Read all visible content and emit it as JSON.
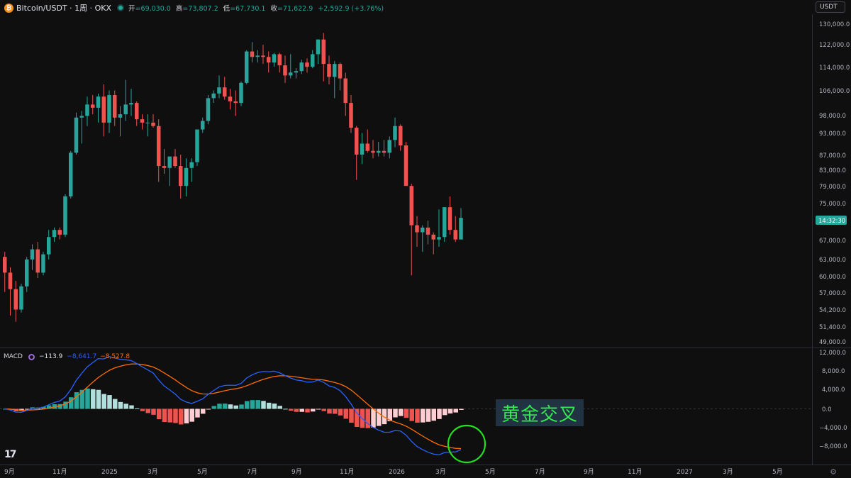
{
  "header": {
    "symbol": "Bitcoin/USDT · 1周 · OKX",
    "open_label": "开",
    "open": "=69,030.0",
    "high_label": "高",
    "high": "=73,807.2",
    "low_label": "低",
    "low": "=67,730.1",
    "close_label": "收",
    "close": "=71,622.9",
    "change": "+2,592.9 (+3.76%)"
  },
  "currency_button": "USDT",
  "price_axis_labels": [
    "130,000.0",
    "122,000.0",
    "114,000.0",
    "106,000.0",
    "98,000.0",
    "93,000.0",
    "87,000.0",
    "83,000.0",
    "79,000.0",
    "75,000.0",
    "67,000.0",
    "63,000.0",
    "60,000.0",
    "57,000.0",
    "54,200.0",
    "51,400.0",
    "49,000.0"
  ],
  "current_price_tag": "14:32:30",
  "macd": {
    "name": "MACD",
    "histogram": "−113.9",
    "macd": "−8,641.7",
    "signal": "−8,527.8",
    "axis_labels": [
      "12,000.0",
      "8,000.0",
      "4,000.0",
      "0.0",
      "−4,000.0",
      "−8,000.0"
    ]
  },
  "time_axis_labels": [
    "9月",
    "11月",
    "2025",
    "3月",
    "5月",
    "7月",
    "9月",
    "11月",
    "2026",
    "3月",
    "5月",
    "7月",
    "9月",
    "11月",
    "2027",
    "3月",
    "5月"
  ],
  "annotation": "黄金交叉",
  "colors": {
    "up": "#26a69a",
    "down": "#ef5350",
    "macd_line": "#2962ff",
    "signal_line": "#ff6d00",
    "annotation_circle": "#22e01e",
    "annotation_text": "#33e84f"
  },
  "chart_data": {
    "type": "candlestick",
    "timeframe": "1W",
    "axis_scale": "log",
    "price_ylim": [
      49000,
      130000
    ],
    "candles_ohlc": [
      [
        63500,
        64500,
        57000,
        60500
      ],
      [
        60500,
        61500,
        53000,
        57500
      ],
      [
        57500,
        59000,
        52000,
        54000
      ],
      [
        54000,
        58500,
        53500,
        58000
      ],
      [
        58000,
        63500,
        57000,
        63000
      ],
      [
        63000,
        66000,
        61000,
        65000
      ],
      [
        65000,
        66500,
        59500,
        60500
      ],
      [
        60500,
        64500,
        60000,
        64000
      ],
      [
        64000,
        69000,
        63000,
        67500
      ],
      [
        67500,
        69500,
        66500,
        69000
      ],
      [
        69000,
        69500,
        67000,
        68000
      ],
      [
        68000,
        77000,
        67500,
        76500
      ],
      [
        76500,
        88000,
        76000,
        87500
      ],
      [
        87500,
        99000,
        87000,
        97500
      ],
      [
        97500,
        99500,
        90000,
        98000
      ],
      [
        98000,
        104000,
        95000,
        101500
      ],
      [
        101500,
        104500,
        98500,
        100500
      ],
      [
        100500,
        105000,
        96000,
        104000
      ],
      [
        104000,
        108000,
        92000,
        96000
      ],
      [
        96000,
        106000,
        93000,
        104500
      ],
      [
        104500,
        106000,
        95000,
        97500
      ],
      [
        97500,
        101000,
        92000,
        98500
      ],
      [
        98500,
        109500,
        96500,
        101500
      ],
      [
        101500,
        106500,
        98000,
        102000
      ],
      [
        102000,
        102500,
        95000,
        97000
      ],
      [
        97000,
        98500,
        94000,
        96000
      ],
      [
        96000,
        98500,
        92000,
        96000
      ],
      [
        96000,
        98500,
        94500,
        95000
      ],
      [
        95000,
        97000,
        80000,
        84000
      ],
      [
        84000,
        88500,
        82000,
        83500
      ],
      [
        83500,
        86000,
        79000,
        86500
      ],
      [
        86500,
        88500,
        83500,
        84000
      ],
      [
        84000,
        87000,
        76000,
        79000
      ],
      [
        79000,
        86000,
        76500,
        83500
      ],
      [
        83500,
        86000,
        80000,
        85000
      ],
      [
        85000,
        93500,
        84000,
        94000
      ],
      [
        94000,
        97500,
        93000,
        96500
      ],
      [
        96500,
        104500,
        95500,
        103500
      ],
      [
        103500,
        106000,
        102000,
        105000
      ],
      [
        105000,
        111000,
        103500,
        107000
      ],
      [
        107000,
        110500,
        103000,
        104000
      ],
      [
        104000,
        106500,
        100000,
        102500
      ],
      [
        102500,
        106000,
        98000,
        102000
      ],
      [
        102000,
        109000,
        101000,
        108500
      ],
      [
        108500,
        120000,
        108000,
        119500
      ],
      [
        119500,
        123000,
        115500,
        117500
      ],
      [
        117500,
        120000,
        115500,
        118000
      ],
      [
        118000,
        122000,
        115000,
        117500
      ],
      [
        117500,
        119500,
        112000,
        115500
      ],
      [
        115500,
        119000,
        114000,
        118500
      ],
      [
        118500,
        119000,
        112000,
        114500
      ],
      [
        114500,
        118000,
        108500,
        111000
      ],
      [
        111000,
        118500,
        110000,
        112000
      ],
      [
        112000,
        113500,
        110000,
        112500
      ],
      [
        112500,
        116500,
        111500,
        115500
      ],
      [
        115500,
        117000,
        112000,
        114000
      ],
      [
        114000,
        120000,
        113500,
        118500
      ],
      [
        118500,
        124000,
        115000,
        124000
      ],
      [
        124000,
        126500,
        109000,
        115000
      ],
      [
        115000,
        118000,
        108000,
        110500
      ],
      [
        110500,
        116000,
        103500,
        115000
      ],
      [
        115000,
        115500,
        106000,
        110000
      ],
      [
        110000,
        112000,
        98000,
        102000
      ],
      [
        102000,
        104500,
        93000,
        94500
      ],
      [
        94500,
        95000,
        80500,
        87000
      ],
      [
        87000,
        93000,
        84500,
        90000
      ],
      [
        90000,
        94000,
        87500,
        88000
      ],
      [
        88000,
        91000,
        86000,
        87500
      ],
      [
        87500,
        90500,
        86500,
        88000
      ],
      [
        88000,
        91000,
        86500,
        87500
      ],
      [
        87500,
        92000,
        86000,
        91000
      ],
      [
        91000,
        97500,
        89000,
        95000
      ],
      [
        95000,
        95500,
        88000,
        89500
      ],
      [
        89500,
        90500,
        80000,
        79000
      ],
      [
        79000,
        79500,
        60000,
        70000
      ],
      [
        70000,
        72000,
        65500,
        68500
      ],
      [
        68500,
        70000,
        64500,
        69500
      ],
      [
        69500,
        71000,
        66000,
        68000
      ],
      [
        68000,
        68500,
        64000,
        67000
      ],
      [
        67000,
        73500,
        65500,
        67500
      ],
      [
        67500,
        74000,
        66500,
        74000
      ],
      [
        74000,
        76500,
        68000,
        69000
      ],
      [
        69000,
        72000,
        66500,
        67000
      ],
      [
        67000,
        73800,
        67700,
        71600
      ]
    ]
  }
}
